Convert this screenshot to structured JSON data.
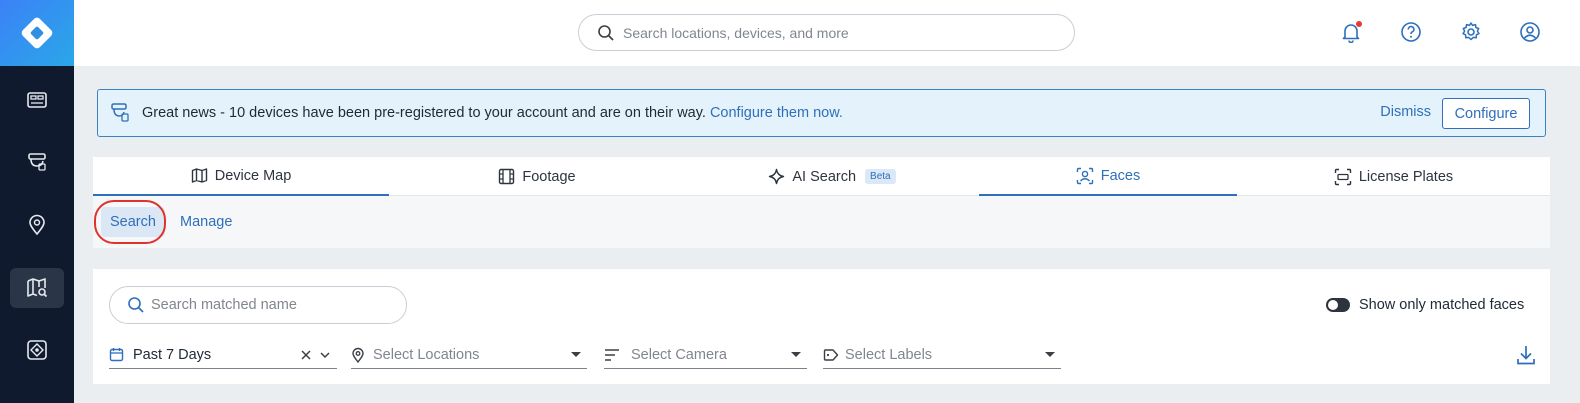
{
  "header": {
    "search_placeholder": "Search locations, devices, and more"
  },
  "sidebar": {
    "items": [
      {
        "icon": "dashboard-icon"
      },
      {
        "icon": "camera-icon"
      },
      {
        "icon": "location-pin-icon"
      },
      {
        "icon": "map-search-icon",
        "active": true
      },
      {
        "icon": "apps-icon"
      }
    ]
  },
  "banner": {
    "message": "Great news - 10 devices have been pre-registered to your account and are on their way.",
    "link": "Configure them now.",
    "dismiss": "Dismiss",
    "configure": "Configure"
  },
  "tabs": [
    {
      "label": "Device Map",
      "icon": "map-icon"
    },
    {
      "label": "Footage",
      "icon": "film-icon"
    },
    {
      "label": "AI Search",
      "icon": "sparkle-icon",
      "badge": "Beta"
    },
    {
      "label": "Faces",
      "icon": "face-scan-icon",
      "active": true
    },
    {
      "label": "License Plates",
      "icon": "license-plate-icon"
    }
  ],
  "subtabs": [
    {
      "label": "Search",
      "active": true
    },
    {
      "label": "Manage"
    }
  ],
  "filters": {
    "name_search_placeholder": "Search matched name",
    "toggle_label": "Show only matched faces",
    "date_value": "Past 7 Days",
    "locations_placeholder": "Select Locations",
    "camera_placeholder": "Select Camera",
    "labels_placeholder": "Select Labels"
  },
  "colors": {
    "accent": "#2f6fbb",
    "sidebar_bg": "#0f1a2e",
    "notification_dot": "#e53935",
    "highlight_ring": "#e0322b"
  }
}
